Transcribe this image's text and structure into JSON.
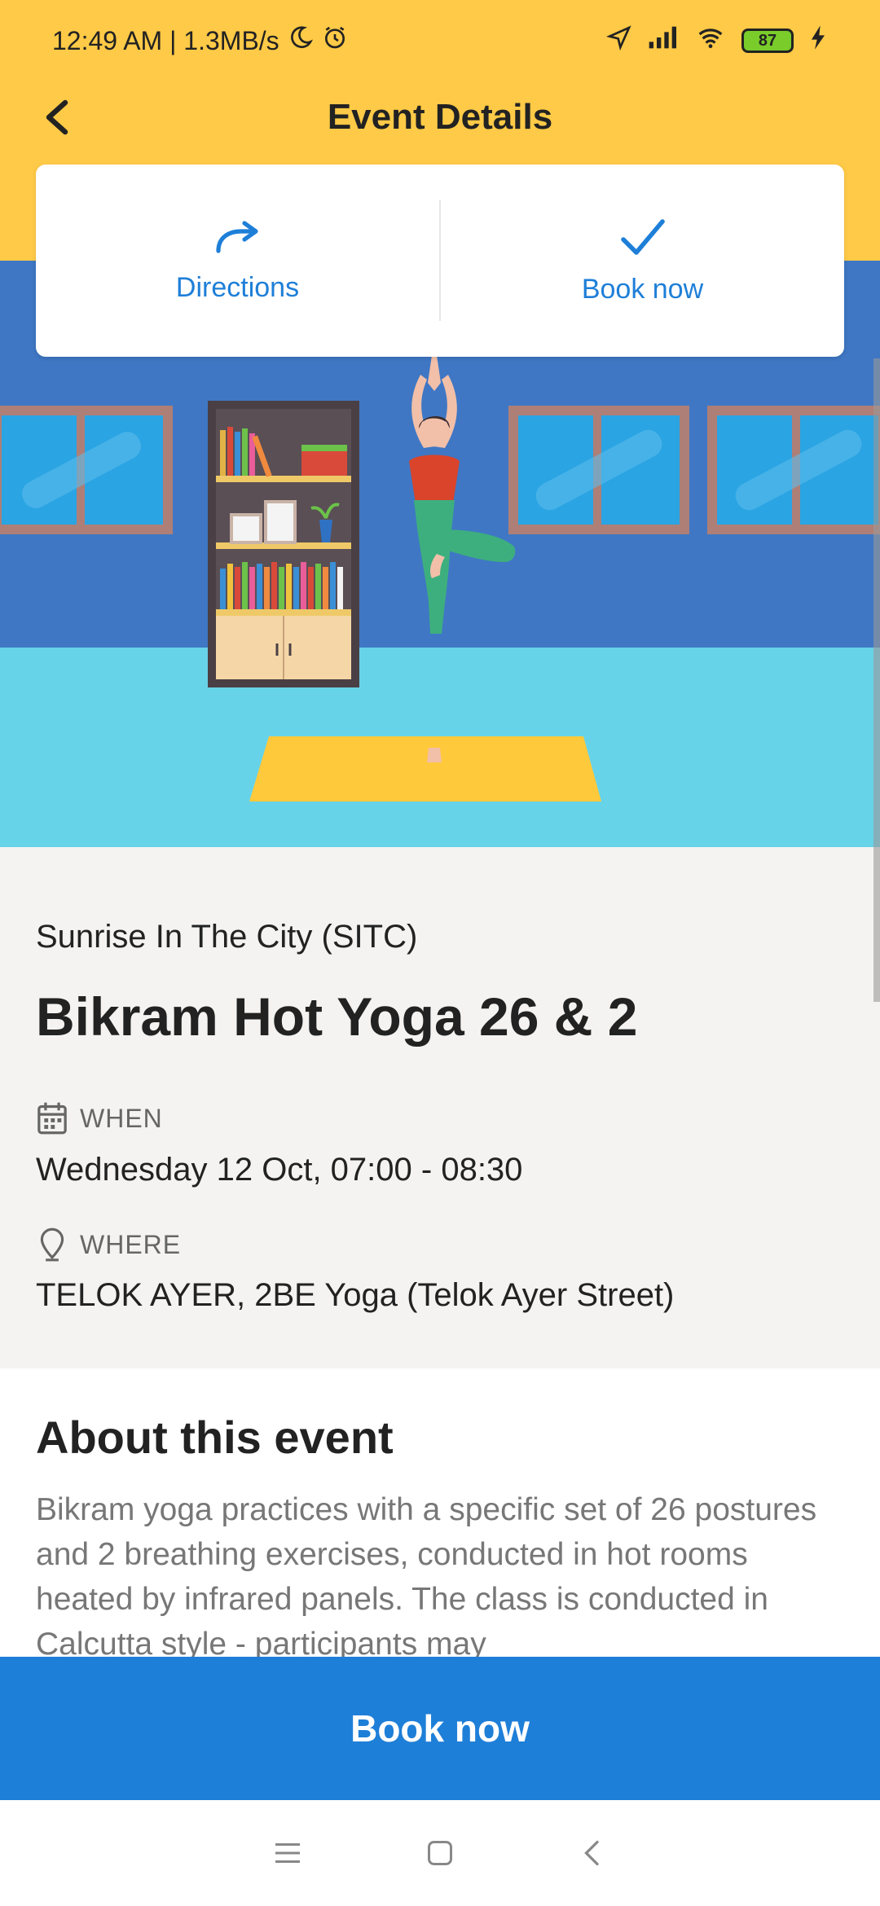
{
  "status_bar": {
    "time_speed": "12:49 AM | 1.3MB/s",
    "battery": "87",
    "icons": [
      "moon-icon",
      "alarm-icon",
      "location-arrow-icon",
      "signal-icon",
      "wifi-icon",
      "battery-icon",
      "charging-icon"
    ]
  },
  "header": {
    "title": "Event Details",
    "back_icon": "chevron-left-icon"
  },
  "actions": {
    "directions_label": "Directions",
    "directions_icon": "share-arrow-icon",
    "book_label": "Book now",
    "book_icon": "checkmark-icon"
  },
  "event": {
    "organizer": "Sunrise In The City (SITC)",
    "title": "Bikram Hot Yoga 26 & 2",
    "when_label": "WHEN",
    "when_value": "Wednesday 12 Oct, 07:00 - 08:30",
    "where_label": "WHERE",
    "where_value": "TELOK AYER, 2BE Yoga (Telok Ayer Street)"
  },
  "about": {
    "title": "About this event",
    "text": "Bikram yoga practices with a specific set of 26 postures and 2 breathing exercises, conducted in hot rooms heated by infrared panels. The class is conducted in Calcutta style - participants may"
  },
  "book_bar": {
    "label": "Book now"
  },
  "nav": {
    "icons": [
      "menu-icon",
      "home-square-icon",
      "back-triangle-icon"
    ]
  },
  "colors": {
    "header_yellow": "#FFCA47",
    "accent_blue": "#1E7FD8",
    "info_bg": "#F4F3F1"
  }
}
